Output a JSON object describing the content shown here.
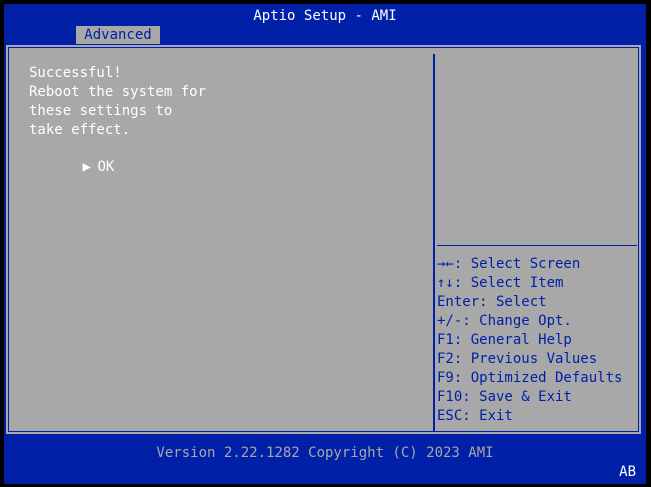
{
  "app": {
    "title": "Aptio Setup - AMI",
    "active_tab": "Advanced"
  },
  "dialog": {
    "message_lines": [
      "Successful!",
      "Reboot the system for",
      "these settings to",
      "take effect."
    ],
    "ok_arrow": "▶",
    "ok_label": "OK"
  },
  "help": {
    "keys": [
      "→←: Select Screen",
      "↑↓: Select Item",
      "Enter: Select",
      "+/-: Change Opt.",
      "F1: General Help",
      "F2: Previous Values",
      "F9: Optimized Defaults",
      "F10: Save & Exit",
      "ESC: Exit"
    ]
  },
  "footer": {
    "version": "Version 2.22.1282 Copyright (C) 2023 AMI",
    "corner_code": "AB"
  },
  "colors": {
    "bios_blue": "#0020a8",
    "bios_gray": "#a8a8a8",
    "text_white": "#ffffff"
  }
}
